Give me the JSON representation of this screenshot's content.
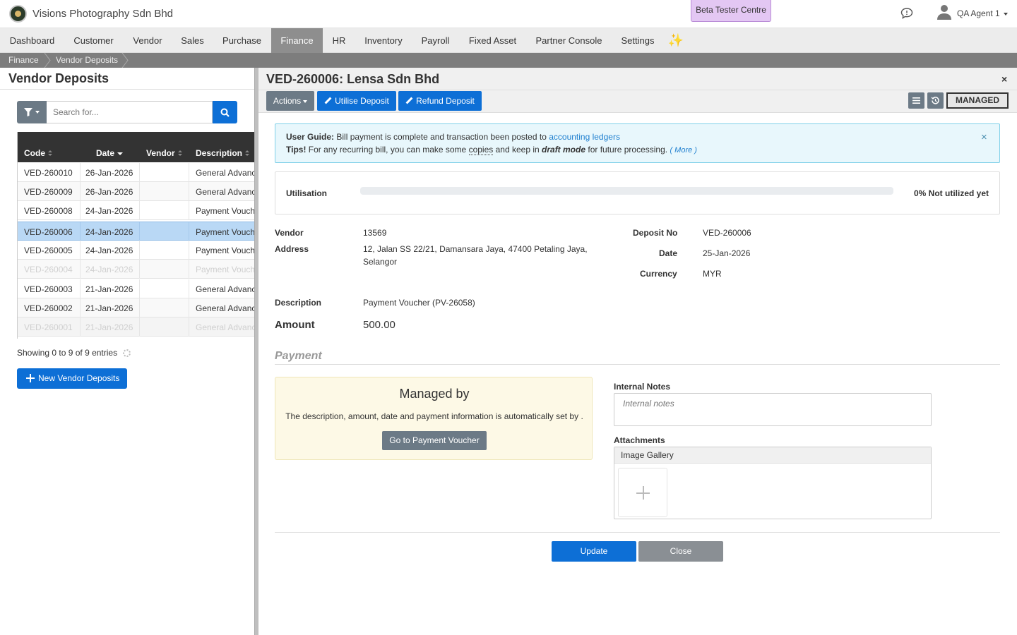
{
  "header": {
    "company": "Visions Photography Sdn Bhd",
    "beta": "Beta Tester Centre",
    "user": "QA Agent 1"
  },
  "nav": {
    "items": [
      "Dashboard",
      "Customer",
      "Vendor",
      "Sales",
      "Purchase",
      "Finance",
      "HR",
      "Inventory",
      "Payroll",
      "Fixed Asset",
      "Partner Console",
      "Settings"
    ],
    "active": "Finance",
    "sparkle": "✨"
  },
  "breadcrumb": [
    "Finance",
    "Vendor Deposits"
  ],
  "list": {
    "title": "Vendor Deposits",
    "search_placeholder": "Search for...",
    "columns": [
      "Code",
      "Date",
      "Vendor",
      "Description"
    ],
    "rows": [
      {
        "code": "VED-260010",
        "date": "26-Jan-2026",
        "vendor": "",
        "description": "General Advance"
      },
      {
        "code": "VED-260009",
        "date": "26-Jan-2026",
        "vendor": "",
        "description": "General Advance"
      },
      {
        "code": "VED-260008",
        "date": "24-Jan-2026",
        "vendor": "",
        "description": "Payment Voucher"
      },
      {
        "code": "VED-260006",
        "date": "24-Jan-2026",
        "vendor": "",
        "description": "Payment Voucher"
      },
      {
        "code": "VED-260005",
        "date": "24-Jan-2026",
        "vendor": "",
        "description": "Payment Voucher"
      },
      {
        "code": "VED-260004",
        "date": "24-Jan-2026",
        "vendor": "",
        "description": "Payment Voucher"
      },
      {
        "code": "VED-260003",
        "date": "21-Jan-2026",
        "vendor": "",
        "description": "General Advance"
      },
      {
        "code": "VED-260002",
        "date": "21-Jan-2026",
        "vendor": "",
        "description": "General Advance"
      },
      {
        "code": "VED-260001",
        "date": "21-Jan-2026",
        "vendor": "",
        "description": "General Advance"
      }
    ],
    "showing": "Showing 0 to 9 of 9 entries",
    "new_button": "New Vendor Deposits"
  },
  "detail": {
    "title": "VED-260006: Lensa Sdn Bhd",
    "close": "×",
    "actions": "Actions",
    "utilise": "Utilise Deposit",
    "refund": "Refund Deposit",
    "status": "MANAGED",
    "guide": {
      "label": "User Guide:",
      "text": "Bill payment is complete and transaction been posted to",
      "link": "accounting ledgers",
      "tips_label": "Tips!",
      "tips_a": "For any recurring bill, you can make some",
      "tips_copies": "copies",
      "tips_b": "and keep in",
      "tips_draft": "draft mode",
      "tips_c": "for future processing.",
      "more": "( More )",
      "close": "×"
    },
    "utilisation": {
      "label": "Utilisation",
      "percent": 0,
      "text": "0% Not utilized yet"
    },
    "fields": {
      "vendor_label": "Vendor",
      "vendor": "13569",
      "address_label": "Address",
      "address_1": "12, Jalan SS 22/21, Damansara Jaya, 47400 Petaling Jaya,",
      "address_2": "Selangor",
      "deposit_no_label": "Deposit No",
      "deposit_no": "VED-260006",
      "date_label": "Date",
      "date": "25-Jan-2026",
      "currency_label": "Currency",
      "currency": "MYR",
      "description_label": "Description",
      "description": "Payment Voucher (PV-26058)",
      "amount_label": "Amount",
      "amount": "500.00"
    },
    "payment": {
      "title": "Payment",
      "managed_title": "Managed by",
      "managed_text": "The description, amount, date and payment information is automatically set by .",
      "go_button": "Go to Payment Voucher",
      "notes_label": "Internal Notes",
      "notes_placeholder": "Internal notes",
      "attachments_label": "Attachments",
      "gallery": "Image Gallery"
    },
    "update": "Update",
    "close_button": "Close"
  }
}
